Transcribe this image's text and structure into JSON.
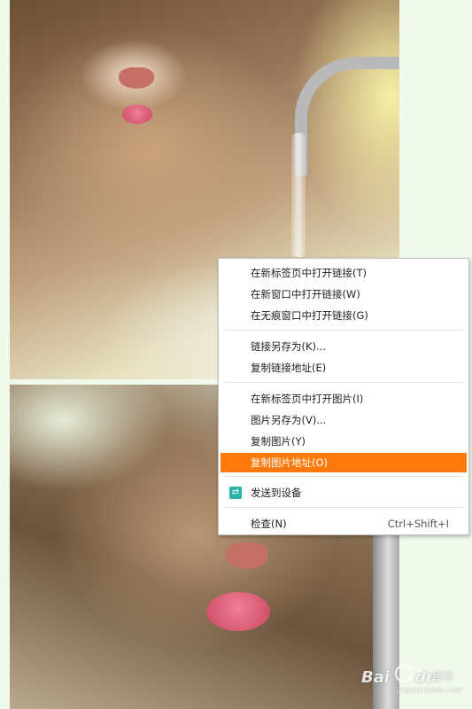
{
  "context_menu": {
    "items": [
      {
        "label": "在新标签页中打开链接(T)"
      },
      {
        "label": "在新窗口中打开链接(W)"
      },
      {
        "label": "在无痕窗口中打开链接(G)"
      },
      {
        "label": "链接另存为(K)..."
      },
      {
        "label": "复制链接地址(E)"
      },
      {
        "label": "在新标签页中打开图片(I)"
      },
      {
        "label": "图片另存为(V)..."
      },
      {
        "label": "复制图片(Y)"
      },
      {
        "label": "复制图片地址(O)",
        "highlighted": true
      },
      {
        "label": "发送到设备",
        "icon": "send-to-device-icon"
      },
      {
        "label": "检查(N)",
        "shortcut": "Ctrl+Shift+I"
      }
    ],
    "highlight_color": "#ff7a0a"
  },
  "watermark": {
    "bai": "Bai",
    "du": "du",
    "jingyan": "经验",
    "url": "jingyan.baidu.com"
  }
}
